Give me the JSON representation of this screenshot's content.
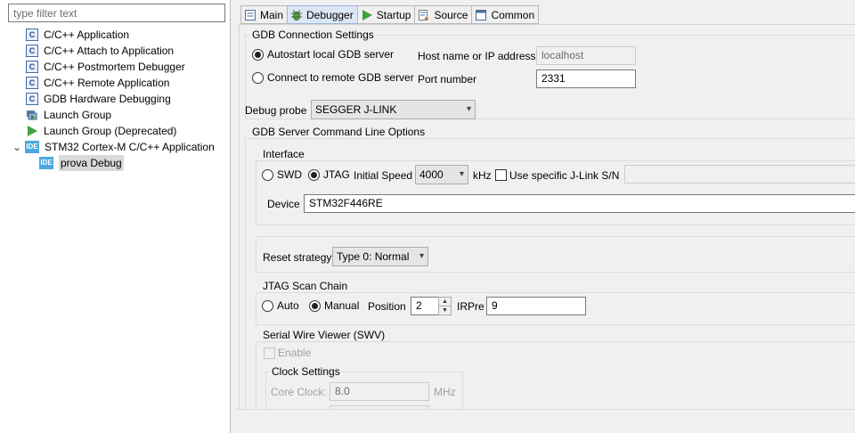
{
  "filter": {
    "placeholder": "type filter text"
  },
  "tree": {
    "items": [
      {
        "label": "C/C++ Application",
        "icon": "c-app-icon"
      },
      {
        "label": "C/C++ Attach to Application",
        "icon": "c-app-icon"
      },
      {
        "label": "C/C++ Postmortem Debugger",
        "icon": "c-app-icon"
      },
      {
        "label": "C/C++ Remote Application",
        "icon": "c-app-icon"
      },
      {
        "label": "GDB Hardware Debugging",
        "icon": "c-app-icon"
      },
      {
        "label": "Launch Group",
        "icon": "launch-group-icon"
      },
      {
        "label": "Launch Group (Deprecated)",
        "icon": "run-icon"
      },
      {
        "label": "STM32 Cortex-M C/C++ Application",
        "icon": "ide-icon"
      },
      {
        "label": "prova Debug",
        "icon": "ide-icon"
      }
    ],
    "icon_text": {
      "c": "C",
      "ide": "IDE"
    },
    "expand_glyph": "⌄"
  },
  "tabs": [
    {
      "label": "Main",
      "icon": "main-icon"
    },
    {
      "label": "Debugger",
      "icon": "debugger-icon"
    },
    {
      "label": "Startup",
      "icon": "startup-icon"
    },
    {
      "label": "Source",
      "icon": "source-icon"
    },
    {
      "label": "Common",
      "icon": "common-icon"
    }
  ],
  "gdb_connection": {
    "title": "GDB Connection Settings",
    "autostart_label": "Autostart local GDB server",
    "remote_label": "Connect to remote GDB server",
    "host_label": "Host name or IP address",
    "host_value": "localhost",
    "port_label": "Port number",
    "port_value": "2331"
  },
  "debug_probe": {
    "label": "Debug probe",
    "value": "SEGGER J-LINK"
  },
  "gdb_server_options": {
    "title": "GDB Server Command Line Options",
    "interface": {
      "title": "Interface",
      "swd_label": "SWD",
      "jtag_label": "JTAG",
      "speed_label": "Initial Speed",
      "speed_value": "4000",
      "speed_unit": "kHz",
      "jlink_sn_label": "Use specific J-Link S/N",
      "device_label": "Device",
      "device_value": "STM32F446RE"
    },
    "reset": {
      "label": "Reset strategy",
      "value": "Type 0: Normal"
    },
    "jtag_scan_chain": {
      "title": "JTAG Scan Chain",
      "auto_label": "Auto",
      "manual_label": "Manual",
      "position_label": "Position",
      "position_value": "2",
      "irpre_label": "IRPre",
      "irpre_value": "9"
    },
    "swv": {
      "title": "Serial Wire Viewer (SWV)",
      "enable_label": "Enable",
      "clock_settings_title": "Clock Settings",
      "core_clock_label": "Core Clock:",
      "core_clock_value": "8.0",
      "core_clock_unit": "MHz"
    }
  },
  "arrows": {
    "down": "▾",
    "up": "▲",
    "dn": "▼"
  }
}
